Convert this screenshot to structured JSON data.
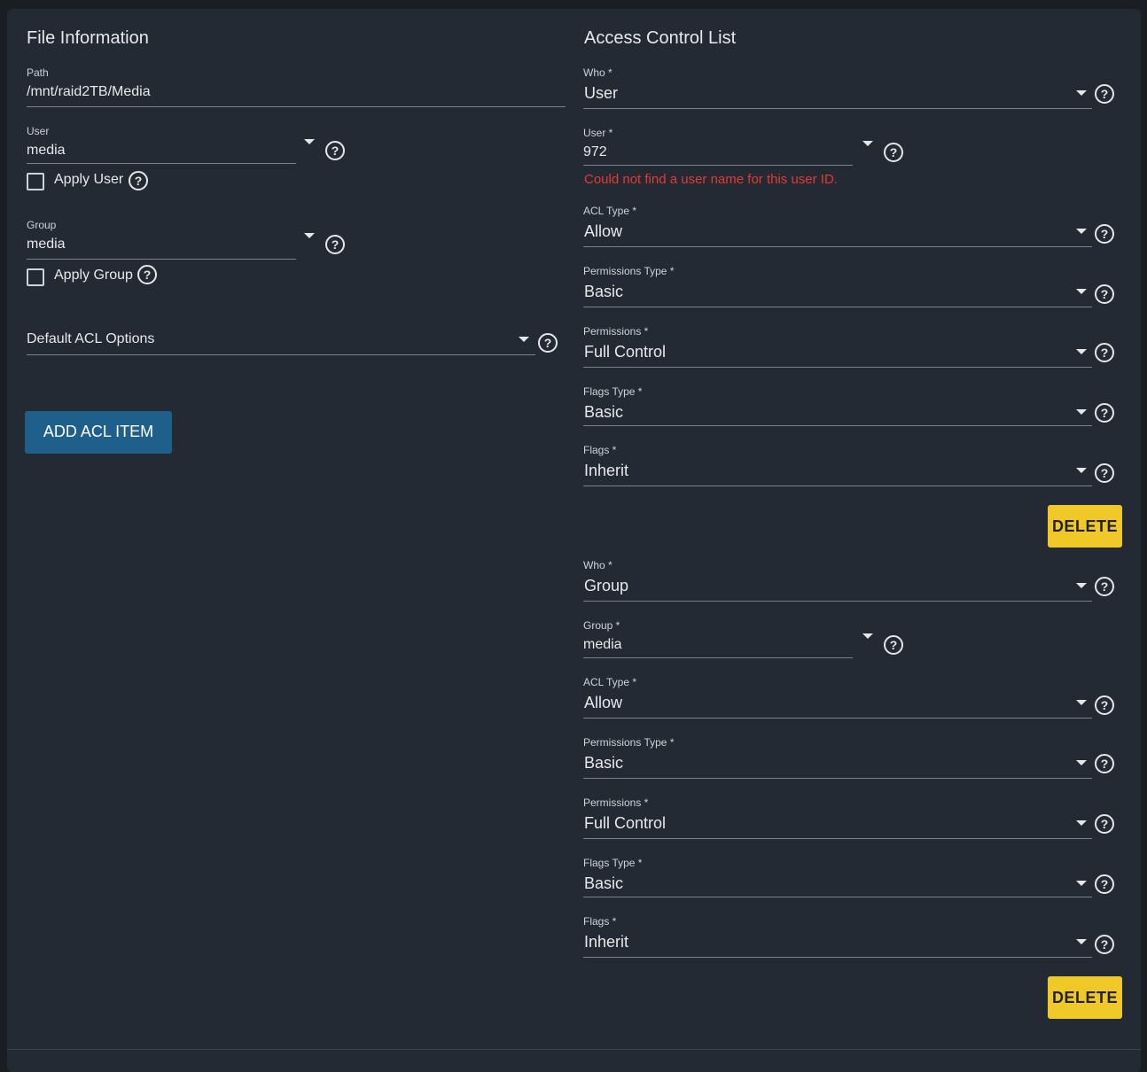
{
  "file_info": {
    "title": "File Information",
    "path": {
      "label": "Path",
      "value": "/mnt/raid2TB/Media"
    },
    "user": {
      "label": "User",
      "value": "media",
      "apply_label": "Apply User"
    },
    "group": {
      "label": "Group",
      "value": "media",
      "apply_label": "Apply Group"
    },
    "default_acl": {
      "placeholder": "Default ACL Options"
    },
    "add_button": "ADD ACL ITEM"
  },
  "acl": {
    "title": "Access Control List",
    "items": [
      {
        "who": {
          "label": "Who *",
          "value": "User"
        },
        "principal": {
          "label": "User *",
          "value": "972",
          "error": "Could not find a user name for this user ID."
        },
        "acl_type": {
          "label": "ACL Type *",
          "value": "Allow"
        },
        "perm_type": {
          "label": "Permissions Type *",
          "value": "Basic"
        },
        "perms": {
          "label": "Permissions *",
          "value": "Full Control"
        },
        "flags_type": {
          "label": "Flags Type *",
          "value": "Basic"
        },
        "flags": {
          "label": "Flags *",
          "value": "Inherit"
        },
        "delete": "DELETE"
      },
      {
        "who": {
          "label": "Who *",
          "value": "Group"
        },
        "principal": {
          "label": "Group *",
          "value": "media"
        },
        "acl_type": {
          "label": "ACL Type *",
          "value": "Allow"
        },
        "perm_type": {
          "label": "Permissions Type *",
          "value": "Basic"
        },
        "perms": {
          "label": "Permissions *",
          "value": "Full Control"
        },
        "flags_type": {
          "label": "Flags Type *",
          "value": "Basic"
        },
        "flags": {
          "label": "Flags *",
          "value": "Inherit"
        },
        "delete": "DELETE"
      }
    ]
  },
  "icons": {
    "help": "help-circle-icon",
    "dropdown": "caret-down-icon",
    "checkbox": "checkbox-unchecked-icon"
  },
  "colors": {
    "background": "#232a33",
    "primary": "#1f5f8b",
    "warning": "#f0c929",
    "error": "#e53935"
  }
}
